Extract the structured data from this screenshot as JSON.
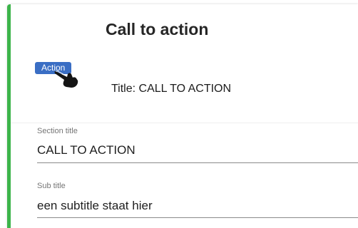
{
  "card": {
    "title": "Call to action",
    "accent_color": "#3cb44a"
  },
  "preview": {
    "badge_label": "Action",
    "badge_color": "#3a6ec4",
    "title_text": "Title: CALL TO ACTION",
    "cursor_icon": "hand-pointer-icon"
  },
  "fields": {
    "section_title": {
      "label": "Section title",
      "value": "CALL TO ACTION"
    },
    "sub_title": {
      "label": "Sub title",
      "value": "een subtitle staat hier"
    }
  }
}
